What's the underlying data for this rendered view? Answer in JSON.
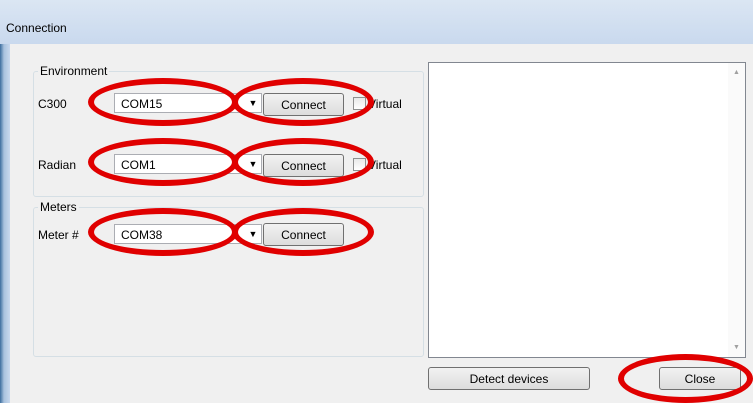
{
  "window": {
    "title": "Connection"
  },
  "environment": {
    "title": "Environment",
    "c300": {
      "label": "C300",
      "port": "COM15",
      "connect_label": "Connect",
      "virtual_label": "Virtual"
    },
    "radian": {
      "label": "Radian",
      "port": "COM1",
      "connect_label": "Connect",
      "virtual_label": "Virtual"
    }
  },
  "meters": {
    "title": "Meters",
    "meter1": {
      "label": "Meter #",
      "port": "COM38",
      "connect_label": "Connect"
    }
  },
  "footer": {
    "detect_label": "Detect devices",
    "close_label": "Close"
  },
  "icons": {
    "dropdown": "chevron-down-icon",
    "scroll_up": "scroll-up-icon",
    "scroll_down": "scroll-down-icon"
  },
  "colors": {
    "annotation_ring": "#e00000"
  }
}
